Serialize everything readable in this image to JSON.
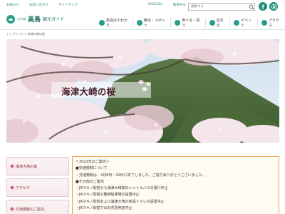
{
  "util_links": [
    "お知らせ",
    "お問い合わせ",
    "サイトマップ"
  ],
  "lang_links": [
    "ENGLISH",
    "繁体中文",
    "한국어"
  ],
  "search": {
    "placeholder": "検索する"
  },
  "logo": {
    "small": "びわ湖",
    "big": "高島",
    "sub": "観光ガイド"
  },
  "nav": [
    {
      "label": "高島はやわかり"
    },
    {
      "label": "観る・スポット"
    },
    {
      "label": "食べる・買う"
    },
    {
      "label": "泊まる"
    },
    {
      "label": "イベント"
    },
    {
      "label": "アクセス"
    }
  ],
  "breadcrumb": "トップページ > 海津大崎の桜",
  "hero": {
    "title": "海津大崎の桜"
  },
  "side_menu": [
    "海津大崎の桜",
    "アクセス",
    "交通規制のご案内"
  ],
  "notice_lines": [
    "＜2022年のご案内＞",
    "■交通規制について",
    "・交通規制は、4月8日・10日に終了しました。ご協力ありがとうございました。",
    "■その他のご案内",
    "・JRマキノ駅前から海津大崎間のシャトルバスの運行中止",
    "・JRマキノ駅前の臨時駐車場の設置中止",
    "・JRマキノ駅前および海津大崎の仮設トイレの設置中止",
    "・JRマキノ駅前でのお花見売店中止"
  ],
  "colors": {
    "accent": "#2a9d8a",
    "notice_border": "#e7a34c",
    "side_text": "#8a2c3c"
  }
}
